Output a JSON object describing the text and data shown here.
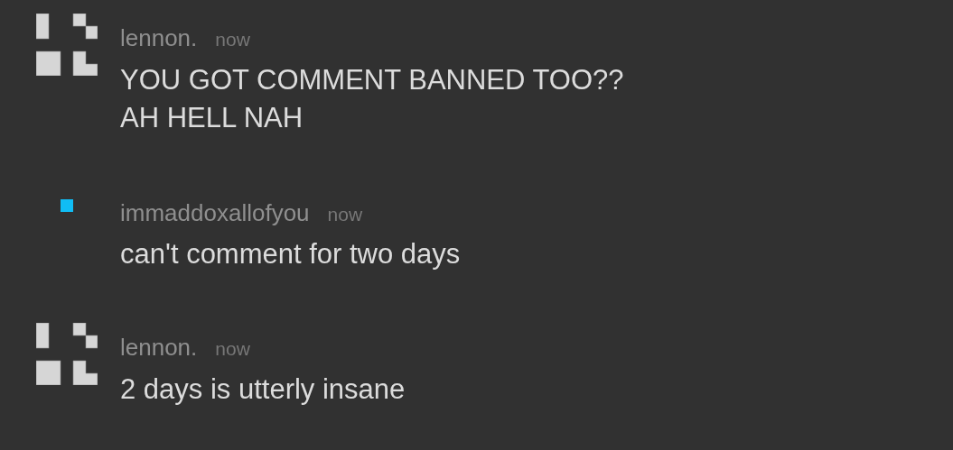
{
  "comments": [
    {
      "avatar": {
        "kind": "pattern"
      },
      "author": "lennon.",
      "time": "now",
      "text": "YOU GOT COMMENT BANNED TOO?? AH HELL NAH"
    },
    {
      "avatar": {
        "kind": "dot",
        "color": "#10bdf5"
      },
      "author": "immaddoxallofyou",
      "time": "now",
      "text": "can't comment for two days"
    },
    {
      "avatar": {
        "kind": "pattern"
      },
      "author": "lennon.",
      "time": "now",
      "text": "2 days is utterly insane"
    }
  ]
}
